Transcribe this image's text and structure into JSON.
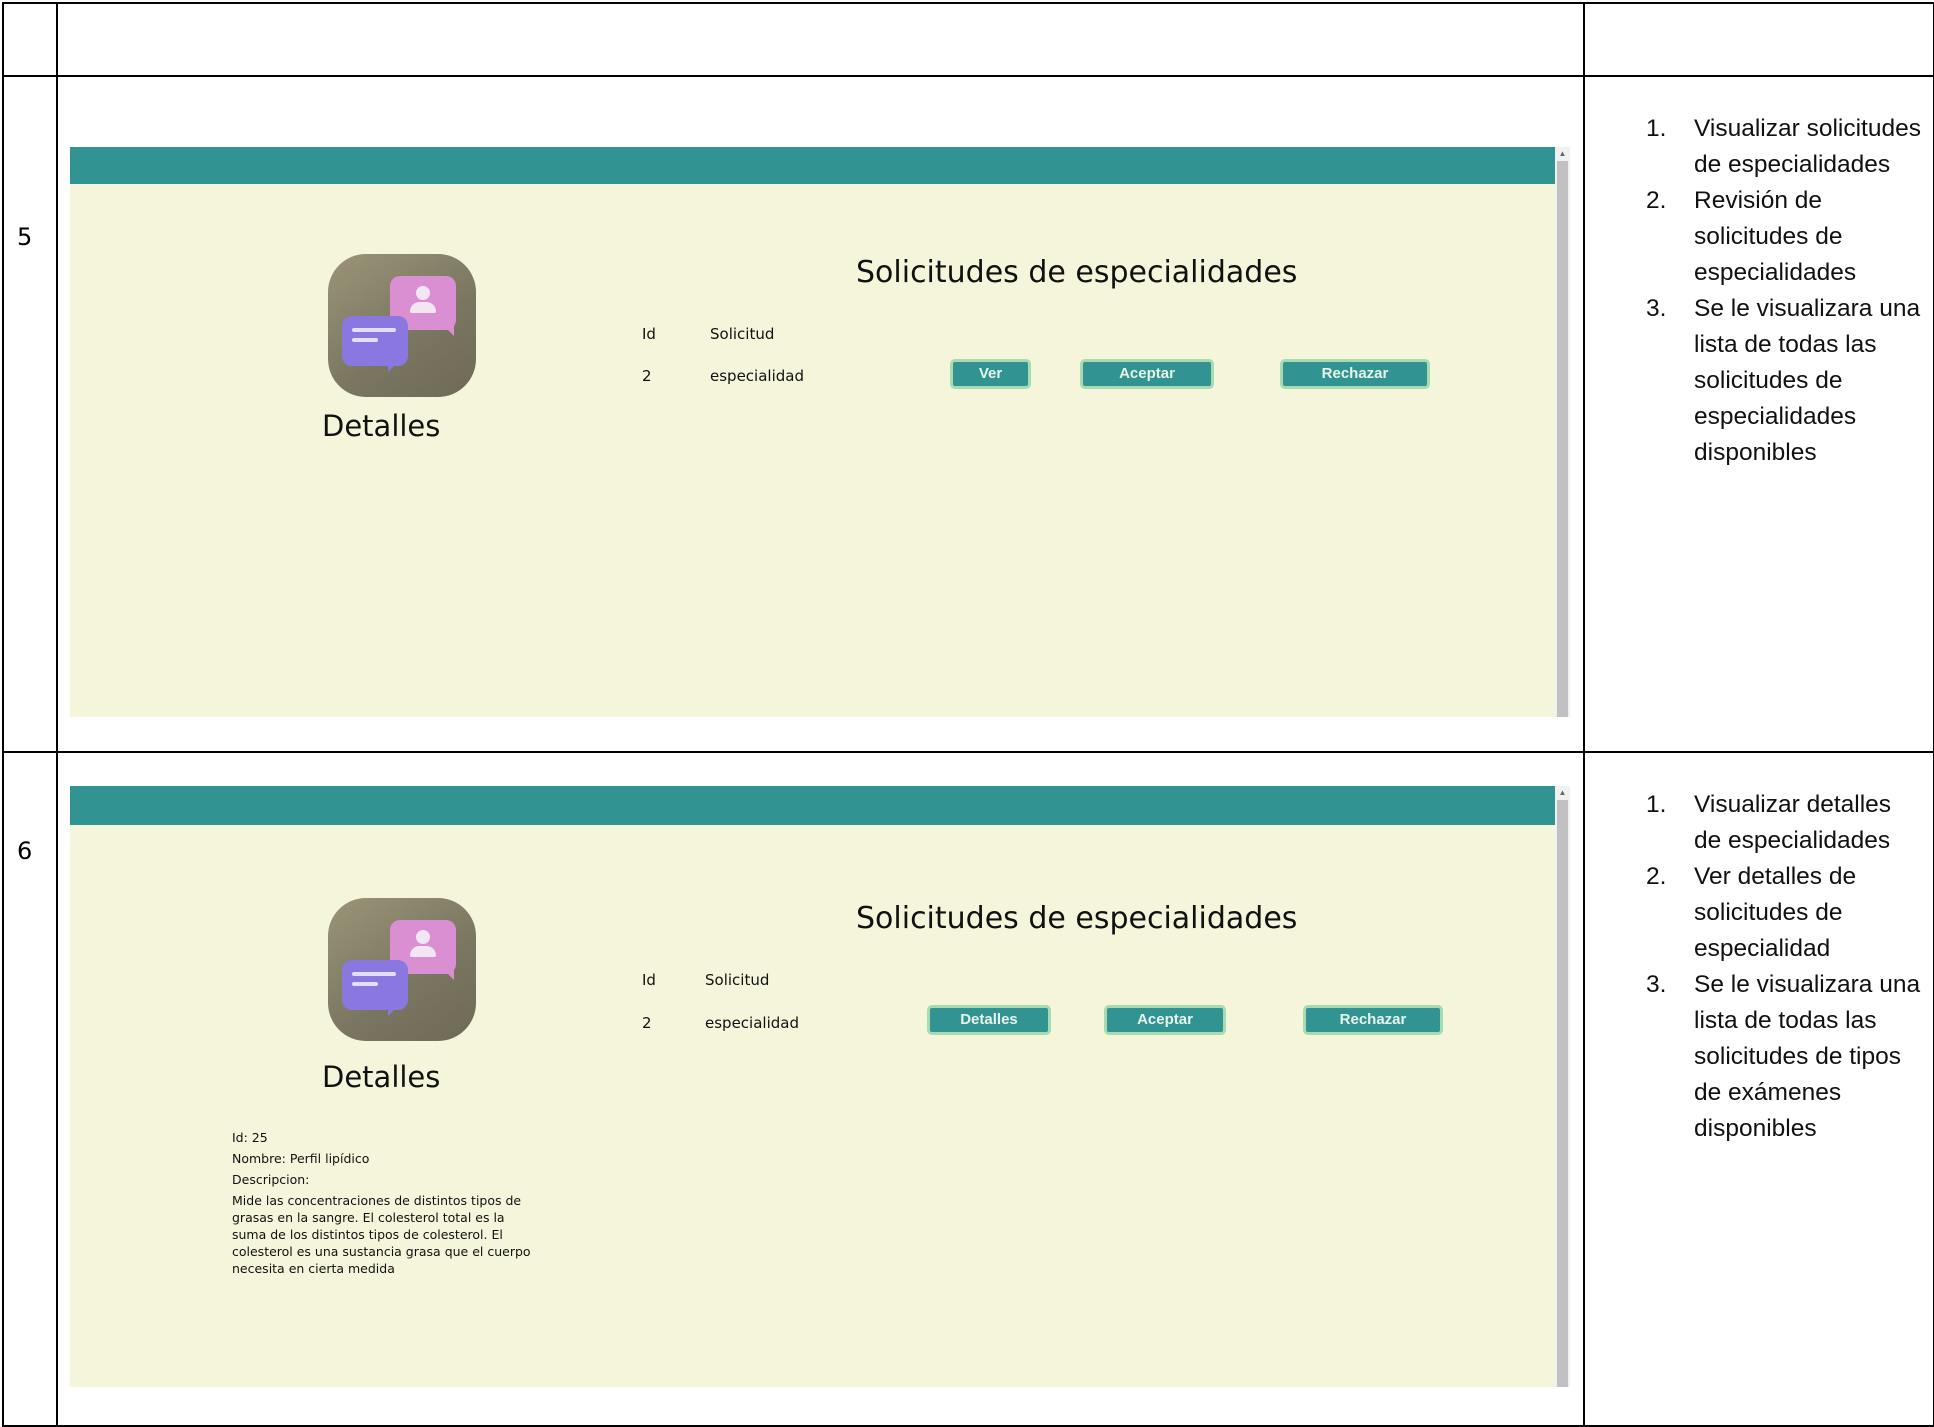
{
  "rows": [
    {
      "number": "5",
      "screenshot": {
        "sidebar_title": "Detalles",
        "page_title": "Solicitudes de especialidades",
        "table_headers": [
          "Id",
          "Solicitud"
        ],
        "row": {
          "id": "2",
          "solicitud": "especialidad"
        },
        "buttons": [
          "Ver",
          "Aceptar",
          "Rechazar"
        ]
      },
      "steps": [
        {
          "n": "1.",
          "text": "Visualizar solicitudes de especialidades"
        },
        {
          "n": "2.",
          "text": "Revisión de solicitudes de especialidades"
        },
        {
          "n": "3.",
          "text": "Se le visualizara una lista de todas las solicitudes de especialidades disponibles"
        }
      ]
    },
    {
      "number": "6",
      "screenshot": {
        "sidebar_title": "Detalles",
        "page_title": "Solicitudes de especialidades",
        "table_headers": [
          "Id",
          "Solicitud"
        ],
        "row": {
          "id": "2",
          "solicitud": "especialidad"
        },
        "buttons": [
          "Detalles",
          "Aceptar",
          "Rechazar"
        ],
        "details": {
          "id": "Id: 25",
          "nombre": "Nombre: Perfil lipídico",
          "descripcion_label": "Descripcion:",
          "descripcion": "Mide las concentraciones de distintos tipos de grasas en la sangre. El colesterol total es la suma de los distintos tipos de colesterol. El colesterol es una sustancia grasa que el cuerpo necesita en cierta medida"
        }
      },
      "steps": [
        {
          "n": "1.",
          "text": "Visualizar detalles de especialidades"
        },
        {
          "n": "2.",
          "text": "Ver detalles de solicitudes de especialidad"
        },
        {
          "n": "3.",
          "text": "Se le visualizara una lista de todas las solicitudes de tipos de exámenes disponibles"
        }
      ]
    }
  ],
  "colors": {
    "header": "#319493",
    "background": "#f5f5dc",
    "button_border": "#a8dcb0"
  },
  "icons": [
    "chat-bubbles-icon"
  ]
}
